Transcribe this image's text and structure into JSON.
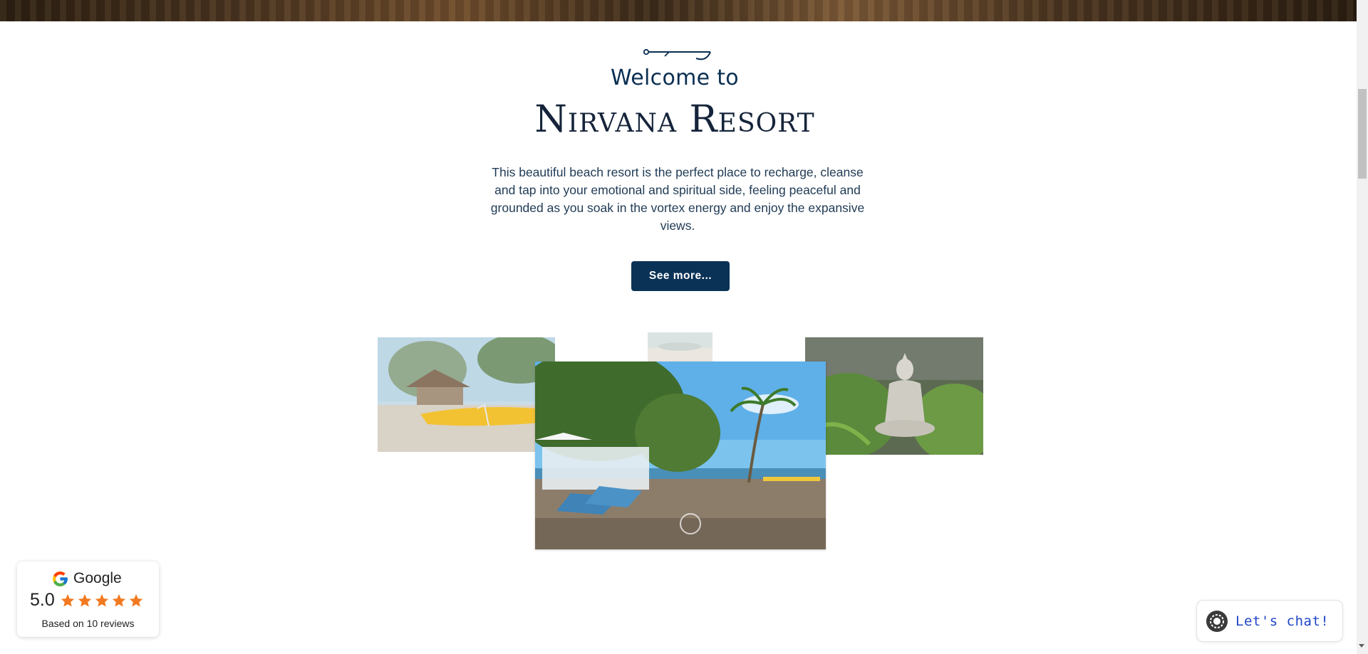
{
  "hero": {
    "welcome": "Welcome to",
    "title": "Nirvana Resort"
  },
  "intro": {
    "text": "This beautiful beach resort is the perfect place to recharge, cleanse and tap into your emotional and spiritual side, feeling peaceful and grounded as you soak in the vortex energy and enjoy the expansive views."
  },
  "cta": {
    "label": "See more..."
  },
  "gallery": {
    "photos": [
      {
        "icon": "beach-kayak-photo"
      },
      {
        "icon": "beach-photo"
      },
      {
        "icon": "buddha-statue-photo"
      },
      {
        "icon": "beach-lounge-chairs-photo"
      }
    ]
  },
  "reviews": {
    "provider": "Google",
    "rating": "5.0",
    "stars": 5,
    "count_text": "Based on 10 reviews",
    "star_color": "#f2791f"
  },
  "chat": {
    "label": "Let's chat!",
    "icon": "chat-logo-icon"
  },
  "colors": {
    "primary": "#0a3256",
    "text": "#1f3a55",
    "chat": "#1e46c8"
  }
}
